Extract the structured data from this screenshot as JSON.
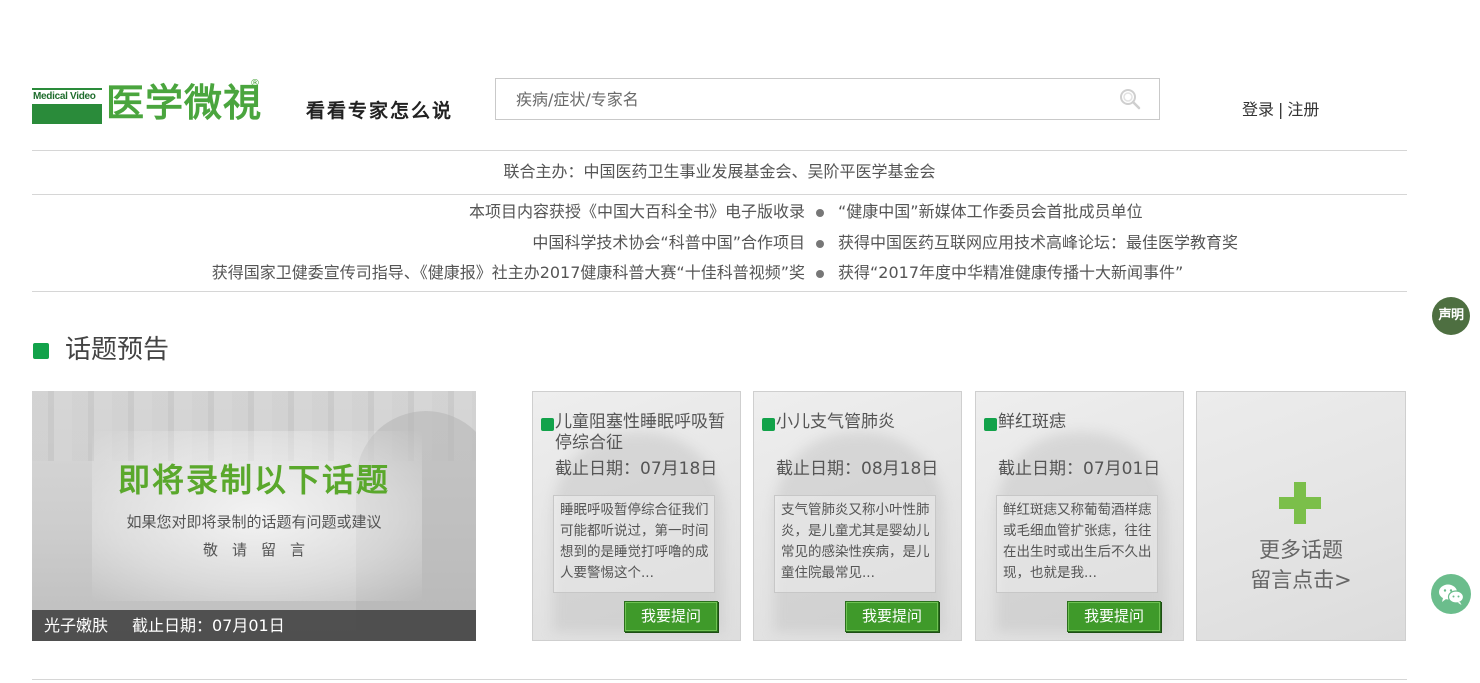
{
  "header": {
    "logo_en": "Medical Video",
    "logo_cn": "医学微視",
    "logo_reg": "®",
    "slogan": "看看专家怎么说",
    "search_placeholder": "疾病/症状/专家名",
    "login": "登录",
    "separator": "|",
    "register": "注册"
  },
  "host_line": "联合主办：中国医药卫生事业发展基金会、吴阶平医学基金会",
  "honors": [
    {
      "left": "本项目内容获授《中国大百科全书》电子版收录",
      "right": "“健康中国”新媒体工作委员会首批成员单位"
    },
    {
      "left": "中国科学技术协会“科普中国”合作项目",
      "right": "获得中国医药互联网应用技术高峰论坛：最佳医学教育奖"
    },
    {
      "left": "获得国家卫健委宣传司指导、《健康报》社主办2017健康科普大赛“十佳科普视频”奖",
      "right": "获得“2017年度中华精准健康传播十大新闻事件”"
    }
  ],
  "section_title": "话题预告",
  "feature": {
    "headline": "即将录制以下话题",
    "subline": "如果您对即将录制的话题有问题或建议",
    "subline2": "敬请留言",
    "topic": "光子嫩肤",
    "deadline": "截止日期：07月01日"
  },
  "topics": [
    {
      "title": "儿童阻塞性睡眠呼吸暂停综合征",
      "deadline": "截止日期：07月18日",
      "desc": "睡眠呼吸暂停综合征我们可能都听说过，第一时间想到的是睡觉打呼噜的成人要警惕这个...",
      "button": "我要提问"
    },
    {
      "title": "小儿支气管肺炎",
      "deadline": "截止日期：08月18日",
      "desc": "支气管肺炎又称小叶性肺炎，是儿童尤其是婴幼儿常见的感染性疾病，是儿童住院最常见...",
      "button": "我要提问"
    },
    {
      "title": "鲜红斑痣",
      "deadline": "截止日期：07月01日",
      "desc": "鲜红斑痣又称葡萄酒样痣或毛细血管扩张痣，往往在出生时或出生后不久出现，也就是我...",
      "button": "我要提问"
    }
  ],
  "more": {
    "line1": "更多话题",
    "line2": "留言点击>"
  },
  "side": {
    "statement": "声明"
  },
  "icons": {
    "search": "search-icon",
    "wechat": "wechat-icon",
    "plus": "plus-icon"
  },
  "colors": {
    "brand_green": "#4aa53e",
    "dot_green": "#12a24a",
    "button_green": "#3f9a2a",
    "statement_bg": "#4e6f41",
    "wechat_bg": "#6bbd8c"
  }
}
